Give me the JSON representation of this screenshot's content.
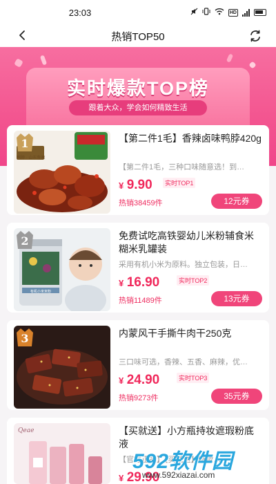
{
  "status_bar": {
    "time": "23:03",
    "network_label": "HD",
    "icons": [
      "mute-icon",
      "vibrate-icon",
      "wifi-icon",
      "hd-icon",
      "signal-icon",
      "battery-icon"
    ]
  },
  "nav": {
    "title": "热销TOP50",
    "back_icon": "chevron-left-icon",
    "refresh_icon": "refresh-icon"
  },
  "banner": {
    "title": "实时爆款TOP榜",
    "subtitle": "跟着大众，学会如何精致生活"
  },
  "products": [
    {
      "rank": "1",
      "title": "【第二件1毛】香辣卤味鸭脖420g",
      "desc": "【第二件1毛，三种口味随意选！到…",
      "price_symbol": "¥",
      "price": "9.90",
      "tag": "实时TOP1",
      "sales": "热销38459件",
      "coupon": "12元券",
      "image_text": "鸭脖 · 山东鲁雁",
      "rank_color": "#c9a05a"
    },
    {
      "rank": "2",
      "title": "免费试吃高铁婴幼儿米粉辅食米糊米乳罐装",
      "desc": "采用有机小米为原料。独立包装，日…",
      "price_symbol": "¥",
      "price": "16.90",
      "tag": "实时TOP2",
      "sales": "热销11489件",
      "coupon": "13元券",
      "image_text": "有机小米米粉",
      "rank_color": "#9b9b9b"
    },
    {
      "rank": "3",
      "title": "内蒙风干手撕牛肉干250克",
      "desc": "三口味可选，香辣、五香、麻辣，优…",
      "price_symbol": "¥",
      "price": "24.90",
      "tag": "实时TOP3",
      "sales": "热销9273件",
      "coupon": "35元券",
      "image_text": "",
      "rank_color": "#d9822b"
    },
    {
      "rank": "",
      "title": "【买就送】小方瓶持妆遮瑕粉底液",
      "desc": "【官方正品】【买就送】持妆…",
      "price_symbol": "¥",
      "price": "29.90",
      "tag": "",
      "sales": "",
      "coupon": "",
      "image_text": "Qeae",
      "rank_color": ""
    }
  ],
  "watermark": {
    "brand": "592软件园",
    "url": "www.592xiazai.com"
  },
  "colors": {
    "accent": "#f0285b",
    "banner": "#f35590",
    "coupon": "#f0457a"
  }
}
